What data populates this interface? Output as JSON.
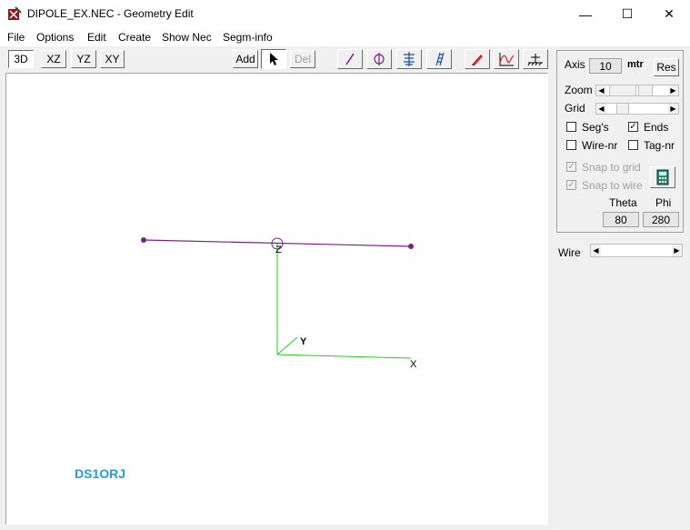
{
  "window": {
    "title": "DIPOLE_EX.NEC - Geometry Edit",
    "minimize": "—",
    "maximize": "☐",
    "close": "✕"
  },
  "menu": [
    "File",
    "Options",
    "Edit",
    "Create",
    "Show Nec",
    "Segm-info"
  ],
  "toolbar": {
    "view_3d": "3D",
    "view_xz": "XZ",
    "view_yz": "YZ",
    "view_xy": "XY",
    "add": "Add",
    "del": "Del",
    "tool_icons": [
      "wire-tool-icon",
      "source-tool-icon",
      "helix-tool-icon",
      "ladder-tool-icon",
      "pencil-icon",
      "plot-icon",
      "ground-icon"
    ]
  },
  "canvas": {
    "axis_z": "Z",
    "axis_y": "Y",
    "axis_x": "X",
    "callsign": "DS1ORJ",
    "colors": {
      "wire": "#7a1f8a",
      "axes": "#22cc22",
      "callsign": "#1e9fe0"
    }
  },
  "panel": {
    "axis_label": "Axis",
    "axis_value": "10",
    "axis_unit": "mtr",
    "res_label": "Res",
    "zoom_label": "Zoom",
    "grid_label": "Grid",
    "segs_label": "Seg's",
    "segs_checked": false,
    "ends_label": "Ends",
    "ends_checked": true,
    "wirenr_label": "Wire-nr",
    "wirenr_checked": false,
    "tagnr_label": "Tag-nr",
    "tagnr_checked": false,
    "snap_grid_label": "Snap to grid",
    "snap_grid_checked": true,
    "snap_wire_label": "Snap to wire",
    "snap_wire_checked": true,
    "theta_label": "Theta",
    "theta_value": "80",
    "phi_label": "Phi",
    "phi_value": "280"
  },
  "wire_selector": {
    "label": "Wire"
  }
}
